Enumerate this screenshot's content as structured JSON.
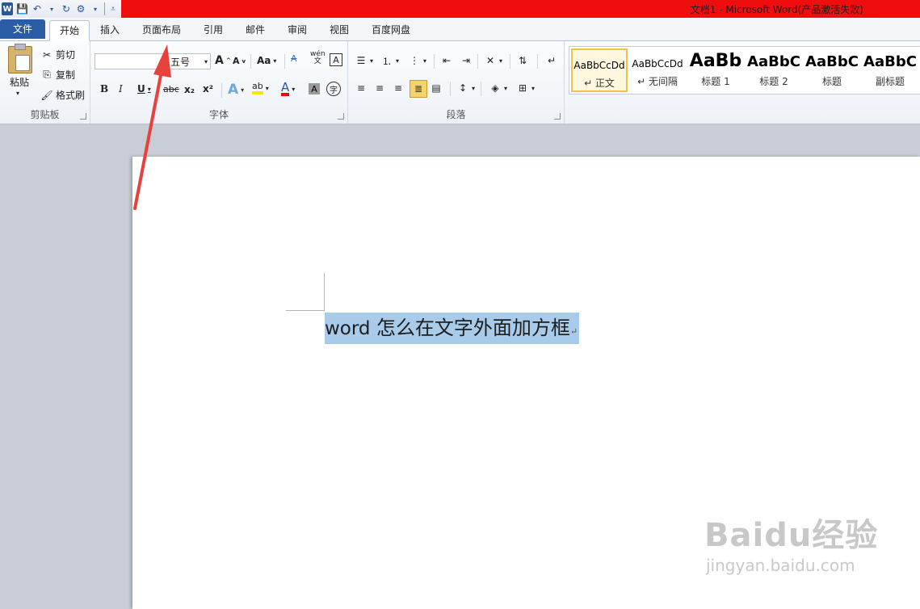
{
  "window": {
    "title": "文档1 - Microsoft Word(产品激活失败)",
    "qat": [
      "word-logo",
      "save",
      "undo",
      "dropdown",
      "redo",
      "customize",
      "qat-dropdown"
    ]
  },
  "tabs": [
    {
      "label": "文件",
      "kind": "file"
    },
    {
      "label": "开始",
      "kind": "active"
    },
    {
      "label": "插入"
    },
    {
      "label": "页面布局"
    },
    {
      "label": "引用"
    },
    {
      "label": "邮件"
    },
    {
      "label": "审阅"
    },
    {
      "label": "视图"
    },
    {
      "label": "百度网盘"
    }
  ],
  "clipboard": {
    "group_label": "剪贴板",
    "paste": "粘贴",
    "cut": "剪切",
    "copy": "复制",
    "format_painter": "格式刷"
  },
  "font": {
    "group_label": "字体",
    "font_name": "",
    "font_size": "五号",
    "grow": "A",
    "shrink": "A",
    "case": "Aa",
    "bold": "B",
    "italic": "I",
    "underline": "U",
    "strike": "abc",
    "subscript": "x₂",
    "superscript": "x²",
    "highlight": "ab",
    "color": "A",
    "shading": "A",
    "enclosed": "字",
    "phonetic": "wén\n文",
    "border_char": "A",
    "clear": "A"
  },
  "paragraph": {
    "group_label": "段落"
  },
  "styles": [
    {
      "sample": "AaBbCcDd",
      "name": "↵ 正文",
      "selected": true
    },
    {
      "sample": "AaBbCcDd",
      "name": "↵ 无间隔"
    },
    {
      "sample": "AaBb",
      "name": "标题 1"
    },
    {
      "sample": "AaBbC",
      "name": "标题 2"
    },
    {
      "sample": "AaBbC",
      "name": "标题"
    },
    {
      "sample": "AaBbC",
      "name": "副标题"
    }
  ],
  "document": {
    "text_en": "word ",
    "text_zh": "怎么在文字外面加方框",
    "para_mark": "↵",
    "selected": true
  },
  "watermark": {
    "main": "Baidu经验",
    "sub": "jingyan.baidu.com"
  },
  "colors": {
    "title_red": "#f00d0d",
    "file_tab": "#2a5ba5",
    "selection": "#a8cbea",
    "arrow": "#e8403a"
  }
}
